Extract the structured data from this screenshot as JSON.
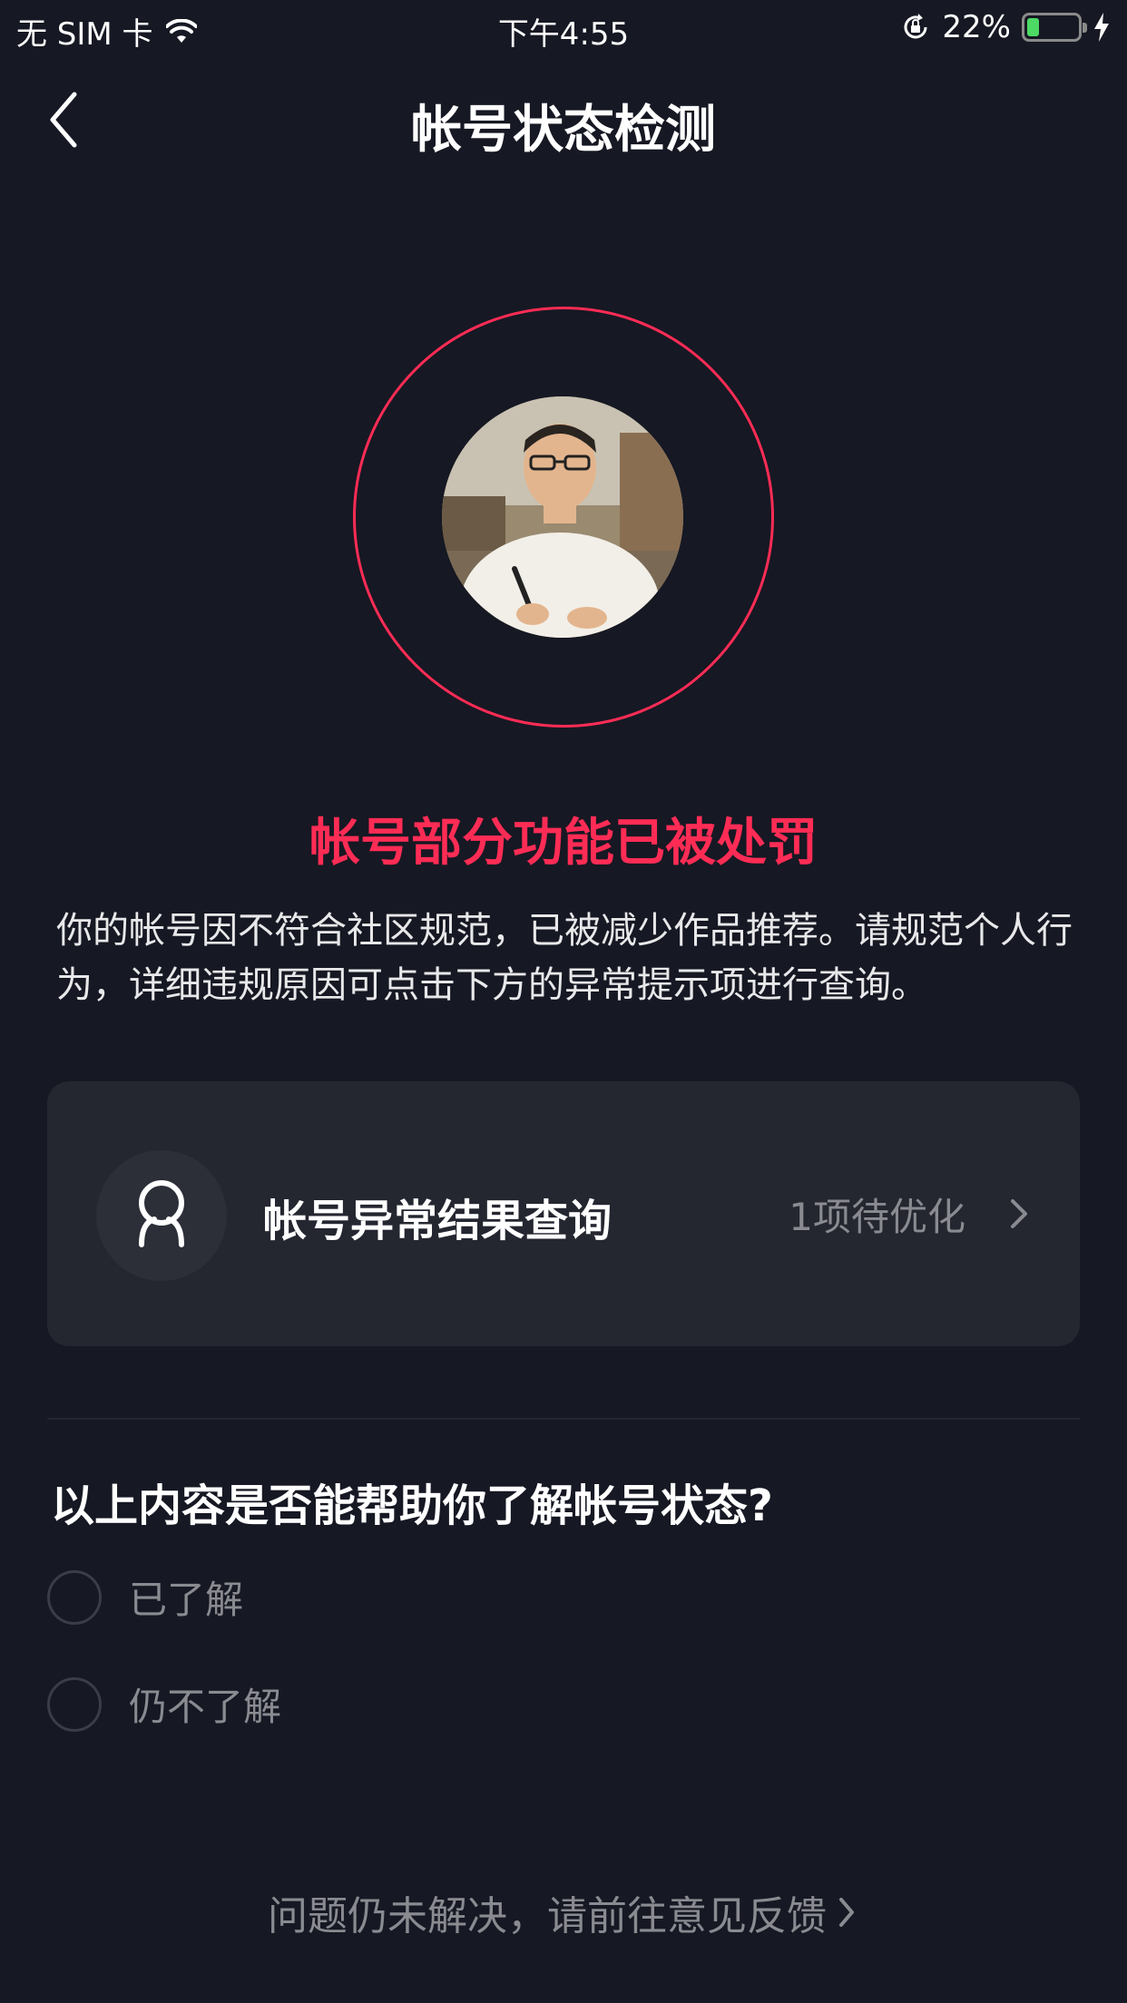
{
  "status_bar": {
    "carrier": "无 SIM 卡",
    "time": "下午4:55",
    "battery_percent": "22%",
    "battery_level": 0.22,
    "icons": [
      "wifi-icon",
      "orientation-lock-icon",
      "battery-icon",
      "charging-icon"
    ]
  },
  "nav": {
    "title": "帐号状态检测",
    "back_icon": "chevron-left-icon"
  },
  "status": {
    "title": "帐号部分功能已被处罚",
    "description": "你的帐号因不符合社区规范，已被减少作品推荐。请规范个人行为，详细违规原因可点击下方的异常提示项进行查询。"
  },
  "card": {
    "icon": "user-icon",
    "title": "帐号异常结果查询",
    "status": "1项待优化"
  },
  "survey": {
    "question": "以上内容是否能帮助你了解帐号状态?",
    "options": [
      "已了解",
      "仍不了解"
    ]
  },
  "footer": {
    "feedback_link": "问题仍未解决，请前往意见反馈"
  },
  "colors": {
    "background": "#161823",
    "accent": "#fe2c55",
    "card": "#242630",
    "muted_text": "#8a8b91"
  }
}
